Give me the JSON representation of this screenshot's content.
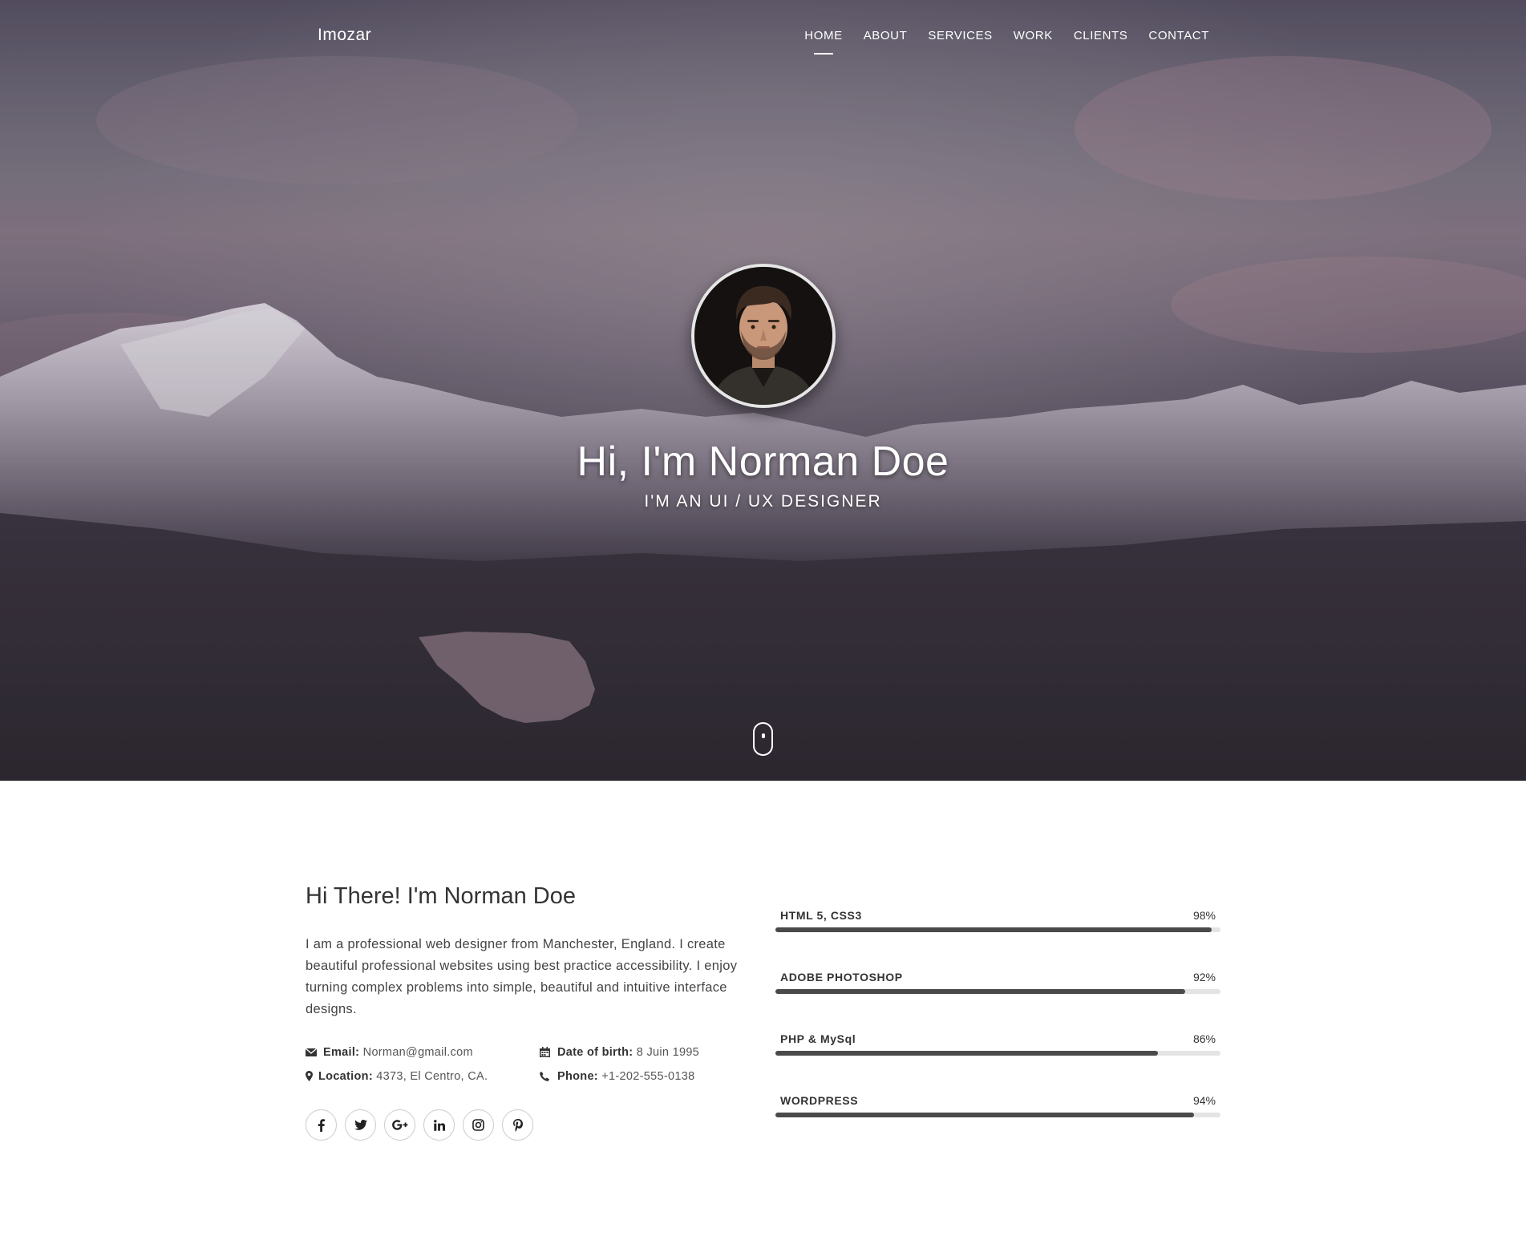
{
  "brand": "Imozar",
  "nav": {
    "items": [
      {
        "label": "HOME",
        "active": true
      },
      {
        "label": "ABOUT",
        "active": false
      },
      {
        "label": "SERVICES",
        "active": false
      },
      {
        "label": "WORK",
        "active": false
      },
      {
        "label": "CLIENTS",
        "active": false
      },
      {
        "label": "CONTACT",
        "active": false
      }
    ]
  },
  "hero": {
    "title": "Hi, I'm Norman Doe",
    "subtitle": "I'M AN UI / UX DESIGNER",
    "scroll_icon": "mouse-scroll-icon"
  },
  "about": {
    "heading": "Hi There! I'm Norman Doe",
    "text": "I am a professional web designer from Manchester, England. I create beautiful professional websites using best practice accessibility. I enjoy turning complex problems into simple, beautiful and intuitive interface designs.",
    "info": {
      "email": {
        "label": "Email:",
        "value": "Norman@gmail.com",
        "icon": "envelope-icon"
      },
      "dob": {
        "label": "Date of birth:",
        "value": "8 Juin 1995",
        "icon": "calendar-icon"
      },
      "location": {
        "label": "Location:",
        "value": "4373, El Centro, CA.",
        "icon": "map-marker-icon"
      },
      "phone": {
        "label": "Phone:",
        "value": "+1-202-555-0138",
        "icon": "phone-icon"
      }
    },
    "social": [
      "facebook-icon",
      "twitter-icon",
      "google-plus-icon",
      "linkedin-icon",
      "instagram-icon",
      "pinterest-icon"
    ]
  },
  "skills": [
    {
      "name": "HTML 5, CSS3",
      "percent_label": "98%",
      "percent": 98
    },
    {
      "name": "ADOBE PHOTOSHOP",
      "percent_label": "92%",
      "percent": 92
    },
    {
      "name": "PHP & MySql",
      "percent_label": "86%",
      "percent": 86
    },
    {
      "name": "WORDPRESS",
      "percent_label": "94%",
      "percent": 94
    }
  ],
  "colors": {
    "skill_fill": "#4a4a4a",
    "skill_track": "#e4e4e4",
    "hero_text": "#ffffff"
  }
}
